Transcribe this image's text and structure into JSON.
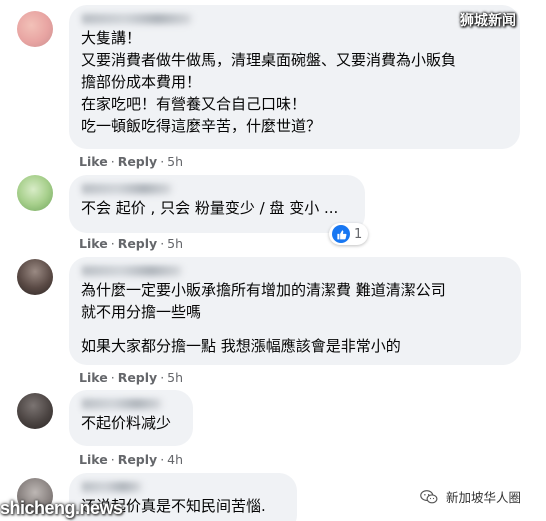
{
  "watermarks": {
    "top_right": "狮城新闻",
    "bottom_left": "shicheng.news",
    "bottom_right": "新加坡华人圈"
  },
  "colors": {
    "bubble": "#f0f2f5",
    "meta_text": "#65676b",
    "like_blue": "#1877f2"
  },
  "comments": [
    {
      "author": "... .a",
      "lines": [
        "大隻講！",
        "又要消費者做牛做馬，清理桌面碗盤、又要消費為小販負",
        "擔部份成本費用！",
        "在家吃吧！有營養又合自己口味！",
        "吃一頓飯吃得這麼辛苦，什麼世道？"
      ],
      "like": "Like",
      "reply": "Reply",
      "time": "5h"
    },
    {
      "author": "...........g",
      "lines": [
        "不会 起价 , 只会 粉量变少 / 盘 变小 ..."
      ],
      "like": "Like",
      "reply": "Reply",
      "time": "5h",
      "reaction_count": "1"
    },
    {
      "author": "............",
      "lines": [
        "為什麼一定要小販承擔所有增加的清潔費 難道清潔公司",
        "就不用分擔一些嗎"
      ],
      "lines2": [
        "如果大家都分擔一點 我想漲幅應該會是非常小的"
      ],
      "like": "Like",
      "reply": "Reply",
      "time": "5h"
    },
    {
      "author": "........",
      "lines": [
        "不起价料减少"
      ],
      "like": "Like",
      "reply": "Reply",
      "time": "4h"
    },
    {
      "author": ".....",
      "lines": [
        "还说起价真是不知民间苦惱."
      ]
    }
  ],
  "icons": {
    "like_reaction": "thumbs-up-icon",
    "wechat": "wechat-icon"
  }
}
